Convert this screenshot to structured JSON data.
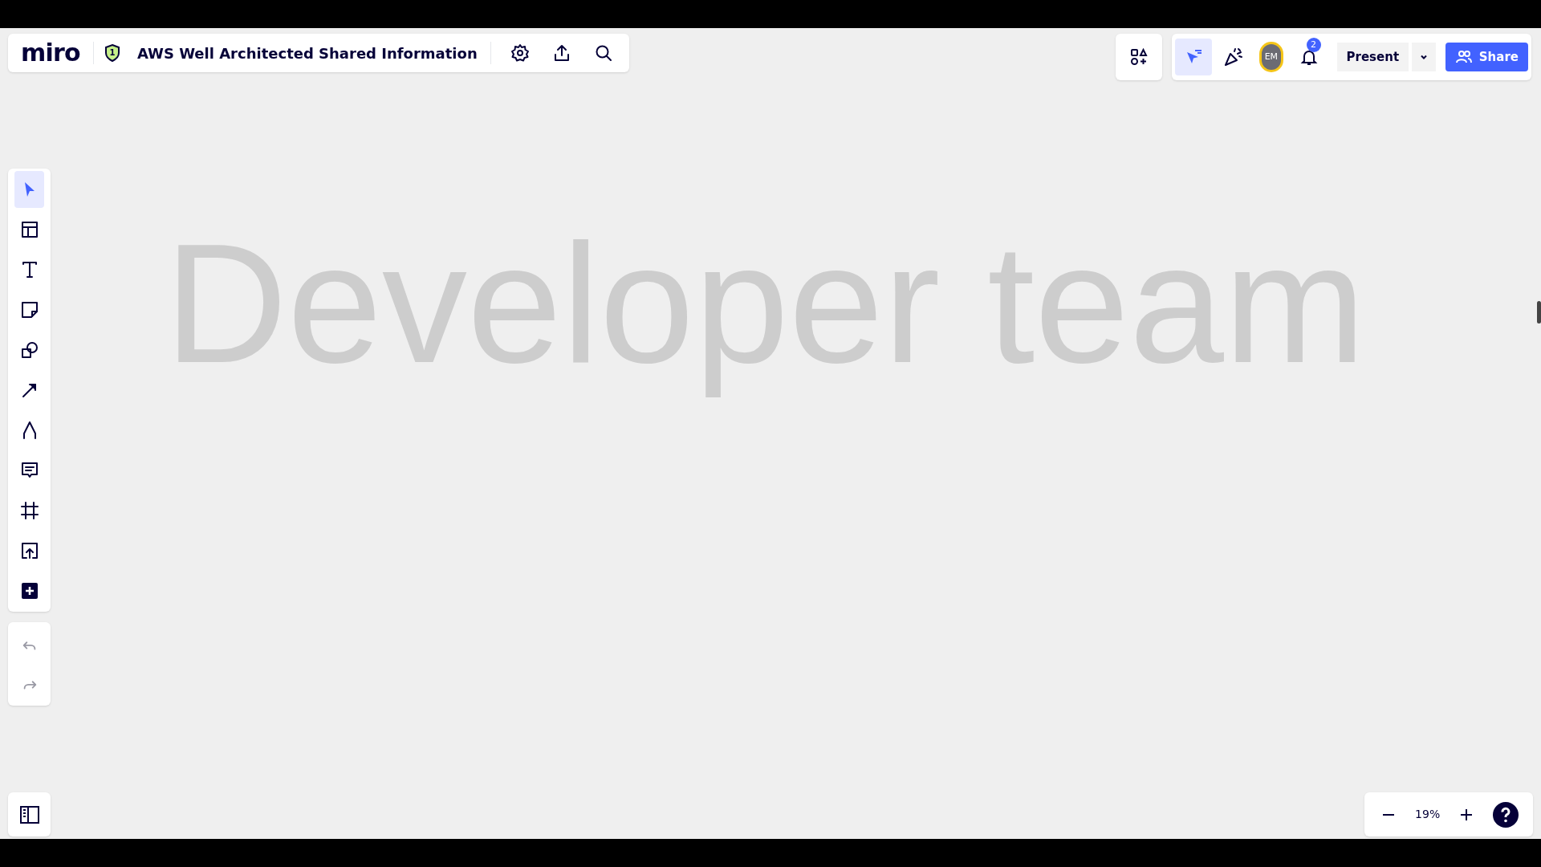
{
  "board": {
    "logo": "miro",
    "shield_badge": "1",
    "title": "AWS Well Architected Shared Information"
  },
  "board_actions": [
    {
      "kind": "settings"
    },
    {
      "kind": "export"
    },
    {
      "kind": "search"
    }
  ],
  "collab_tools": [
    {
      "kind": "cursor",
      "selected": true
    },
    {
      "kind": "celebrate",
      "selected": false
    }
  ],
  "avatar": {
    "initials": "EM"
  },
  "notifications": {
    "count": "2"
  },
  "present_button": "Present",
  "share_button": "Share",
  "toolbar": [
    {
      "kind": "select",
      "selected": true
    },
    {
      "kind": "templates",
      "selected": false
    },
    {
      "kind": "text",
      "selected": false
    },
    {
      "kind": "sticky",
      "selected": false
    },
    {
      "kind": "shapes",
      "selected": false
    },
    {
      "kind": "line",
      "selected": false
    },
    {
      "kind": "pen",
      "selected": false
    },
    {
      "kind": "comment",
      "selected": false
    },
    {
      "kind": "frame",
      "selected": false
    },
    {
      "kind": "upload",
      "selected": false
    },
    {
      "kind": "more",
      "selected": false
    }
  ],
  "history": [
    {
      "kind": "undo",
      "disabled": true
    },
    {
      "kind": "redo",
      "disabled": true
    }
  ],
  "canvas": {
    "text": "Developer team"
  },
  "zoom": {
    "level_text": "19%"
  }
}
